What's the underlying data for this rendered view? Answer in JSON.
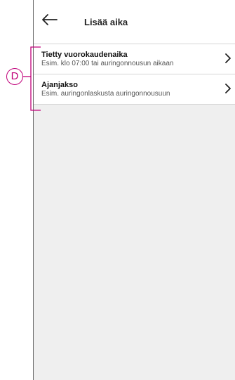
{
  "header": {
    "title": "Lisää aika"
  },
  "items": [
    {
      "title": "Tietty vuorokaudenaika",
      "subtitle": "Esim. klo 07:00 tai auringonnousun aikaan"
    },
    {
      "title": "Ajanjakso",
      "subtitle": "Esim. auringonlaskusta auringonnousuun"
    }
  ],
  "callout": {
    "label": "D",
    "color": "#c0007a"
  },
  "icons": {
    "back": "back-arrow-icon",
    "chevron": "chevron-right-icon"
  }
}
